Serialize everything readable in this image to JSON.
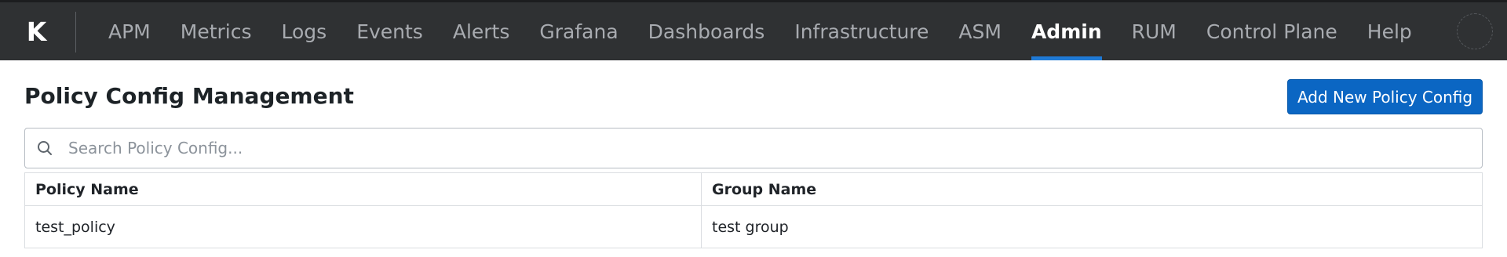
{
  "app": {
    "logo_letter": "K"
  },
  "nav": {
    "items": [
      {
        "label": "APM",
        "active": false
      },
      {
        "label": "Metrics",
        "active": false
      },
      {
        "label": "Logs",
        "active": false
      },
      {
        "label": "Events",
        "active": false
      },
      {
        "label": "Alerts",
        "active": false
      },
      {
        "label": "Grafana",
        "active": false
      },
      {
        "label": "Dashboards",
        "active": false
      },
      {
        "label": "Infrastructure",
        "active": false
      },
      {
        "label": "ASM",
        "active": false
      },
      {
        "label": "Admin",
        "active": true
      },
      {
        "label": "RUM",
        "active": false
      },
      {
        "label": "Control Plane",
        "active": false
      },
      {
        "label": "Help",
        "active": false
      }
    ],
    "active_indicator_color": "#1f7ad6",
    "background_color": "#2f3133"
  },
  "page": {
    "title": "Policy Config Management",
    "add_button_label": "Add New Policy Config",
    "primary_color": "#0b66c3"
  },
  "search": {
    "placeholder": "Search Policy Config...",
    "value": "",
    "icon": "search-icon"
  },
  "table": {
    "columns": [
      "Policy Name",
      "Group Name"
    ],
    "rows": [
      [
        "test_policy",
        "test group"
      ]
    ]
  }
}
